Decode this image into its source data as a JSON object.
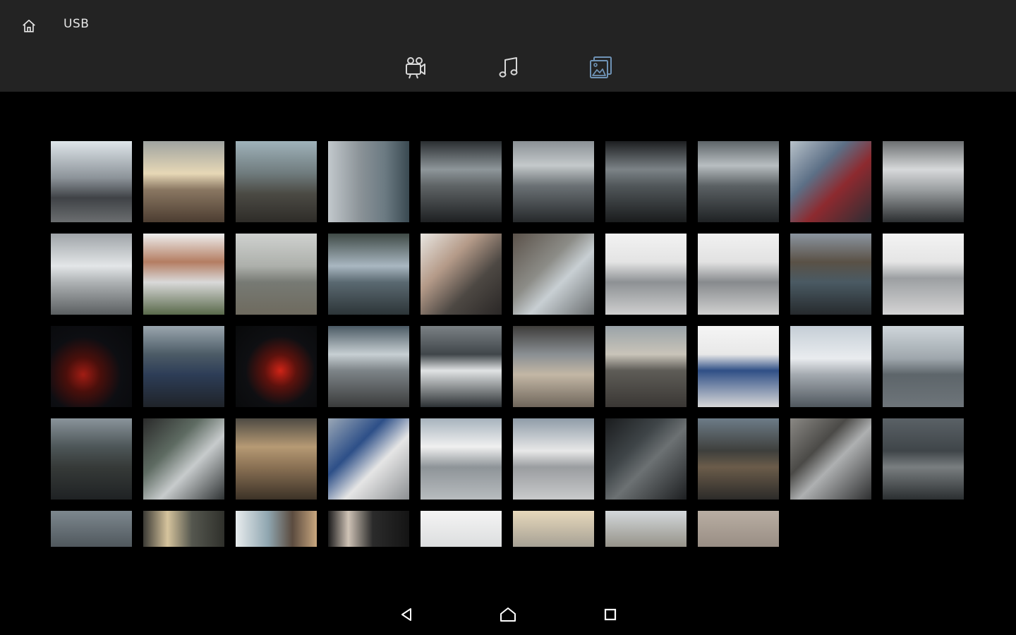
{
  "header": {
    "source_label": "USB",
    "home_icon": "home-icon",
    "tabs": [
      {
        "icon": "video-icon",
        "active": false
      },
      {
        "icon": "music-note-icon",
        "active": false
      },
      {
        "icon": "photo-gallery-icon",
        "active": true
      }
    ]
  },
  "colors": {
    "topbar": "#232323",
    "background": "#000000",
    "icon_inactive": "#d8d8d8",
    "icon_active": "#6f93b6"
  },
  "gallery": {
    "columns": 10,
    "thumbnails": [
      {
        "bg": "linear-gradient(180deg,#dfe6ea 0%,#8d949a 45%,#3f4246 70%,#6b6e70 100%)"
      },
      {
        "bg": "linear-gradient(180deg,#9fa3a0 0%,#e7d8b6 40%,#8a7762 60%,#4c3d31 100%)"
      },
      {
        "bg": "linear-gradient(180deg,#9fb2ba 0%,#6f7b7d 40%,#4b4a44 65%,#2e2c28 100%)"
      },
      {
        "bg": "linear-gradient(90deg,#c2c8cc 0%,#8a9297 40%,#6b7a82 70%,#3a4a52 100%)"
      },
      {
        "bg": "linear-gradient(180deg,#2a2e31 0%,#8e969a 35%,#5f6466 55%,#1e2022 100%)"
      },
      {
        "bg": "linear-gradient(180deg,#8a9094 0%,#c4c9cb 30%,#6b7175 55%,#26292b 100%)"
      },
      {
        "bg": "linear-gradient(180deg,#1c1e20 0%,#7c8387 35%,#51575a 55%,#1a1c1d 100%)"
      },
      {
        "bg": "linear-gradient(180deg,#5d6468 0%,#b8bec1 30%,#5b6164 55%,#1f2224 100%)"
      },
      {
        "bg": "linear-gradient(135deg,#b7c1c9 0%,#5c6f86 35%,#8d2a2f 60%,#2d2d33 100%)"
      },
      {
        "bg": "linear-gradient(180deg,#6c6f71 0%,#d7d9da 35%,#9b9fa1 60%,#2c2f31 100%)"
      },
      {
        "bg": "linear-gradient(180deg,#9fa4a8 0%,#e3e6e8 40%,#aeb2b4 60%,#5b5f61 100%)"
      },
      {
        "bg": "linear-gradient(180deg,#eeeeee 0%,#b47d62 35%,#d9d9d9 60%,#59694a 100%)"
      },
      {
        "bg": "linear-gradient(180deg,#cfd1cf 0%,#adb0ab 40%,#777a74 60%,#6e6a5e 100%)"
      },
      {
        "bg": "linear-gradient(180deg,#3f4a46 0%,#a9b7c1 40%,#5a6971 60%,#2d3538 100%)"
      },
      {
        "bg": "linear-gradient(135deg,#e9e6e1 0%,#b49a88 35%,#4d4843 65%,#2a2726 100%)"
      },
      {
        "bg": "linear-gradient(135deg,#5b524a 0%,#8c8c87 40%,#c8cfd3 60%,#6a6e70 100%)"
      },
      {
        "bg": "linear-gradient(180deg,#f2f2f2 0%,#e4e4e4 35%,#8d9194 60%,#cfcfcf 100%)"
      },
      {
        "bg": "linear-gradient(180deg,#f1f1f1 0%,#e2e2e2 35%,#878a8d 60%,#d0d0d0 100%)"
      },
      {
        "bg": "linear-gradient(180deg,#8b95a0 0%,#5a5146 35%,#4a5a63 60%,#262a2d 100%)"
      },
      {
        "bg": "linear-gradient(180deg,#f3f3f3 0%,#e5e5e5 35%,#9c9fa2 55%,#d4d4d4 100%)"
      },
      {
        "bg": "radial-gradient(circle at 40% 60%,#a21d14 0%,#4a0f0b 25%,#0d0e12 55%,#08090b 100%)"
      },
      {
        "bg": "linear-gradient(180deg,#9aa6ae 0%,#4c5b66 35%,#2d3d57 60%,#1f2329 100%)"
      },
      {
        "bg": "radial-gradient(circle at 55% 55%,#d02417 0%,#5d120d 25%,#0e0f12 55%,#08090a 100%)"
      },
      {
        "bg": "linear-gradient(180deg,#4b5a64 0%,#c7cfd3 35%,#7d8488 55%,#3a3b3b 100%)"
      },
      {
        "bg": "linear-gradient(180deg,#7b8185 0%,#40464a 35%,#e0e3e4 55%,#2c3134 100%)"
      },
      {
        "bg": "linear-gradient(180deg,#3e3d3b 0%,#8a8f93 35%,#c3b7a5 60%,#6f665b 100%)"
      },
      {
        "bg": "linear-gradient(180deg,#9aa3a8 0%,#c9c4b9 35%,#5e5c57 55%,#3a3734 100%)"
      },
      {
        "bg": "linear-gradient(180deg,#f5f5f5 0%,#e8e8e8 35%,#2f4f86 55%,#d8d8d8 100%)"
      },
      {
        "bg": "linear-gradient(180deg,#c5ced6 0%,#e9ecef 40%,#a4aab0 60%,#4f575e 100%)"
      },
      {
        "bg": "linear-gradient(180deg,#cfd6db 0%,#9fa7ad 40%,#5d656a 60%,#6e757a 100%)"
      },
      {
        "bg": "linear-gradient(180deg,#8a949b 0%,#4d5658 35%,#363a38 60%,#1f2224 100%)"
      },
      {
        "bg": "linear-gradient(135deg,#2a2a2a 0%,#5e6b62 35%,#c7cbcc 60%,#2f3334 100%)"
      },
      {
        "bg": "linear-gradient(180deg,#4e4a43 0%,#b69a74 35%,#8a7154 60%,#3c3227 100%)"
      },
      {
        "bg": "linear-gradient(135deg,#9aa7b6 0%,#2d4f88 35%,#e5e5e5 60%,#8c8f92 100%)"
      },
      {
        "bg": "linear-gradient(180deg,#a7b3bd 0%,#f0f0f0 35%,#8e9498 60%,#b8bcbf 100%)"
      },
      {
        "bg": "linear-gradient(180deg,#8f9ca8 0%,#e8e8e8 40%,#9a9da0 60%,#c9cacb 100%)"
      },
      {
        "bg": "linear-gradient(135deg,#1a1c1e 0%,#3f4548 35%,#6c7173 55%,#1d1f21 100%)"
      },
      {
        "bg": "linear-gradient(180deg,#6d7c88 0%,#3e3f3c 40%,#6b5c4a 60%,#2c2b29 100%)"
      },
      {
        "bg": "linear-gradient(135deg,#8a8884 0%,#4b4a47 35%,#aeb0b1 55%,#2e2f30 100%)"
      },
      {
        "bg": "linear-gradient(180deg,#5a6166 0%,#3f4549 40%,#797e80 60%,#2b2f31 100%)"
      },
      {
        "bg": "linear-gradient(180deg,#7d878e 0%,#4a5257 50%,#2c3134 100%)"
      },
      {
        "bg": "linear-gradient(90deg,#3b3a35 0%,#d6c49d 30%,#55574f 60%,#2f302b 100%)"
      },
      {
        "bg": "linear-gradient(90deg,#e8ecee 0%,#8fa6b0 40%,#5b4b3f 70%,#c9a77f 100%)"
      },
      {
        "bg": "linear-gradient(90deg,#1b1b1b 0%,#cfc3b6 25%,#2b2b2b 55%,#141414 100%)"
      },
      {
        "bg": "linear-gradient(180deg,#f4f4f4 0%,#d9dbdc 50%,#9ea2a5 100%)"
      },
      {
        "bg": "linear-gradient(180deg,#e7d8bb 0%,#9e9a90 50%,#35383a 100%)"
      },
      {
        "bg": "linear-gradient(180deg,#d3d8db 0%,#8e8a7f 50%,#3c3f41 100%)"
      },
      {
        "bg": "linear-gradient(180deg,#b9aea3 0%,#8d8279 60%,#5d5550 100%)"
      }
    ]
  },
  "navbar": {
    "back_icon": "back-triangle-icon",
    "home_icon": "home-outline-icon",
    "recents_icon": "recents-square-icon"
  }
}
